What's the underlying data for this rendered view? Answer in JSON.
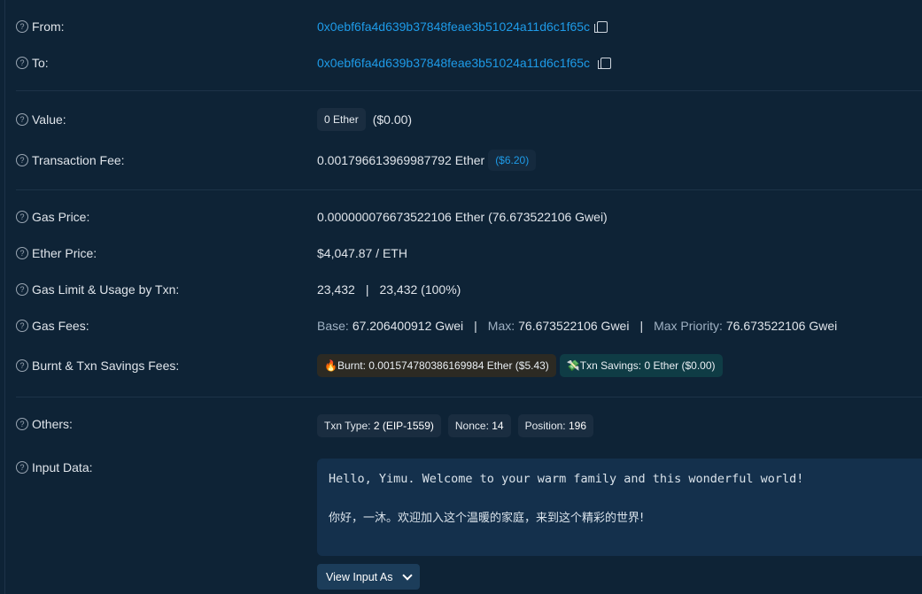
{
  "from": {
    "label": "From:",
    "address": "0x0ebf6fa4d639b37848feae3b51024a11d6c1f65c"
  },
  "to": {
    "label": "To:",
    "address": "0x0ebf6fa4d639b37848feae3b51024a11d6c1f65c"
  },
  "value": {
    "label": "Value:",
    "amount": "0 Ether",
    "usd": "($0.00)"
  },
  "fee": {
    "label": "Transaction Fee:",
    "amount": "0.001796613969987792 Ether",
    "usd": "($6.20)"
  },
  "gas_price": {
    "label": "Gas Price:",
    "value": "0.000000076673522106 Ether (76.673522106 Gwei)"
  },
  "ether_price": {
    "label": "Ether Price:",
    "value": "$4,047.87 / ETH"
  },
  "gas_limit": {
    "label": "Gas Limit & Usage by Txn:",
    "limit": "23,432",
    "separator": "|",
    "usage": "23,432 (100%)"
  },
  "gas_fees": {
    "label": "Gas Fees:",
    "base_label": "Base:",
    "base_value": "67.206400912 Gwei",
    "max_label": "Max:",
    "max_value": "76.673522106 Gwei",
    "priority_label": "Max Priority:",
    "priority_value": "76.673522106 Gwei",
    "separator": "|"
  },
  "burnt": {
    "label": "Burnt & Txn Savings Fees:",
    "burnt_chip": "🔥Burnt: 0.001574780386169984 Ether ($5.43)",
    "savings_chip": "💸Txn Savings: 0 Ether ($0.00)"
  },
  "others": {
    "label": "Others:",
    "txn_type_label": "Txn Type:",
    "txn_type_value": "2 (EIP-1559)",
    "nonce_label": "Nonce:",
    "nonce_value": "14",
    "position_label": "Position:",
    "position_value": "196"
  },
  "input_data": {
    "label": "Input Data:",
    "line1": "Hello, Yimu. Welcome to your warm family and this wonderful world!",
    "line2": "你好，一沐。欢迎加入这个温暖的家庭，来到这个精彩的世界!",
    "view_button": "View Input As"
  },
  "help_glyph": "?",
  "icons": {
    "help": "question-circle-icon",
    "copy": "copy-icon",
    "chevron": "chevron-down-icon"
  }
}
